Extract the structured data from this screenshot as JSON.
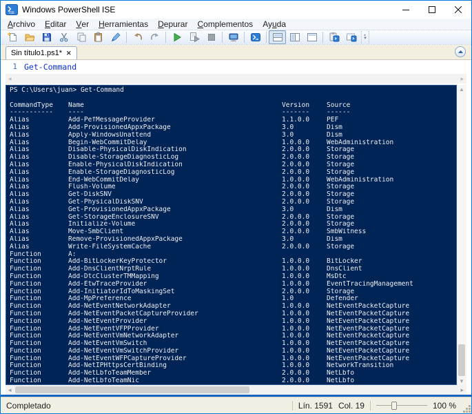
{
  "window": {
    "title": "Windows PowerShell ISE"
  },
  "colors": {
    "accent": "#0078d7",
    "console_bg": "#012456",
    "console_fg": "#eeeef2",
    "status_bg": "#f1efe3",
    "cmdlet_blue": "#0a2fd0"
  },
  "menu": {
    "items": [
      {
        "id": "archivo",
        "pre": "",
        "key": "A",
        "rest": "rchivo"
      },
      {
        "id": "editar",
        "pre": "",
        "key": "E",
        "rest": "ditar"
      },
      {
        "id": "ver",
        "pre": "",
        "key": "V",
        "rest": "er"
      },
      {
        "id": "herramientas",
        "pre": "",
        "key": "H",
        "rest": "erramientas"
      },
      {
        "id": "depurar",
        "pre": "",
        "key": "D",
        "rest": "epurar"
      },
      {
        "id": "complementos",
        "pre": "",
        "key": "C",
        "rest": "omplementos"
      },
      {
        "id": "ayuda",
        "pre": "Ay",
        "key": "u",
        "rest": "da"
      }
    ]
  },
  "toolbar": {
    "items": [
      {
        "id": "new-script",
        "icon": "new-script"
      },
      {
        "id": "open-script",
        "icon": "open-script"
      },
      {
        "id": "save-script",
        "icon": "save-script"
      },
      {
        "id": "cut",
        "icon": "cut"
      },
      {
        "id": "copy",
        "icon": "copy"
      },
      {
        "id": "paste",
        "icon": "paste"
      },
      {
        "id": "clear-console-pane",
        "icon": "clear-console"
      },
      {
        "sep": true
      },
      {
        "id": "undo",
        "icon": "undo"
      },
      {
        "id": "redo",
        "icon": "redo"
      },
      {
        "sep": true
      },
      {
        "id": "run-script",
        "icon": "run-script"
      },
      {
        "id": "run-selection",
        "icon": "run-selection"
      },
      {
        "id": "stop-operation",
        "icon": "stop",
        "disabled": true
      },
      {
        "sep": true
      },
      {
        "id": "new-remote-powershell-tab",
        "icon": "remote-tab"
      },
      {
        "sep": true
      },
      {
        "id": "start-powershell-exe",
        "icon": "powershell"
      },
      {
        "sep": true
      },
      {
        "id": "show-script-pane-top",
        "icon": "pane-top",
        "selected": true
      },
      {
        "id": "show-script-pane-right",
        "icon": "pane-right"
      },
      {
        "id": "show-script-pane-maximized",
        "icon": "pane-max"
      },
      {
        "sep": true
      },
      {
        "id": "show-command-addon",
        "icon": "cmd-clipboard"
      },
      {
        "id": "show-command-window",
        "icon": "cmd-window"
      }
    ]
  },
  "editor": {
    "tab_title": "Sin título1.ps1*",
    "line_number": "1",
    "code": "Get-Command"
  },
  "console": {
    "prompt_line": "PS C:\\Users\\juan> Get-Command",
    "columns": [
      "CommandType",
      "Name",
      "Version",
      "Source"
    ],
    "underlines": [
      "-----------",
      "----",
      "-------",
      "------"
    ],
    "rows": [
      [
        "Alias",
        "Add-PefMessageProvider",
        "1.1.0.0",
        "PEF"
      ],
      [
        "Alias",
        "Add-ProvisionedAppxPackage",
        "3.0",
        "Dism"
      ],
      [
        "Alias",
        "Apply-WindowsUnattend",
        "3.0",
        "Dism"
      ],
      [
        "Alias",
        "Begin-WebCommitDelay",
        "1.0.0.0",
        "WebAdministration"
      ],
      [
        "Alias",
        "Disable-PhysicalDiskIndication",
        "2.0.0.0",
        "Storage"
      ],
      [
        "Alias",
        "Disable-StorageDiagnosticLog",
        "2.0.0.0",
        "Storage"
      ],
      [
        "Alias",
        "Enable-PhysicalDiskIndication",
        "2.0.0.0",
        "Storage"
      ],
      [
        "Alias",
        "Enable-StorageDiagnosticLog",
        "2.0.0.0",
        "Storage"
      ],
      [
        "Alias",
        "End-WebCommitDelay",
        "1.0.0.0",
        "WebAdministration"
      ],
      [
        "Alias",
        "Flush-Volume",
        "2.0.0.0",
        "Storage"
      ],
      [
        "Alias",
        "Get-DiskSNV",
        "2.0.0.0",
        "Storage"
      ],
      [
        "Alias",
        "Get-PhysicalDiskSNV",
        "2.0.0.0",
        "Storage"
      ],
      [
        "Alias",
        "Get-ProvisionedAppxPackage",
        "3.0",
        "Dism"
      ],
      [
        "Alias",
        "Get-StorageEnclosureSNV",
        "2.0.0.0",
        "Storage"
      ],
      [
        "Alias",
        "Initialize-Volume",
        "2.0.0.0",
        "Storage"
      ],
      [
        "Alias",
        "Move-SmbClient",
        "2.0.0.0",
        "SmbWitness"
      ],
      [
        "Alias",
        "Remove-ProvisionedAppxPackage",
        "3.0",
        "Dism"
      ],
      [
        "Alias",
        "Write-FileSystemCache",
        "2.0.0.0",
        "Storage"
      ],
      [
        "Function",
        "A:",
        "",
        ""
      ],
      [
        "Function",
        "Add-BitLockerKeyProtector",
        "1.0.0.0",
        "BitLocker"
      ],
      [
        "Function",
        "Add-DnsClientNrptRule",
        "1.0.0.0",
        "DnsClient"
      ],
      [
        "Function",
        "Add-DtcClusterTMMapping",
        "1.0.0.0",
        "MsDtc"
      ],
      [
        "Function",
        "Add-EtwTraceProvider",
        "1.0.0.0",
        "EventTracingManagement"
      ],
      [
        "Function",
        "Add-InitiatorIdToMaskingSet",
        "2.0.0.0",
        "Storage"
      ],
      [
        "Function",
        "Add-MpPreference",
        "1.0",
        "Defender"
      ],
      [
        "Function",
        "Add-NetEventNetworkAdapter",
        "1.0.0.0",
        "NetEventPacketCapture"
      ],
      [
        "Function",
        "Add-NetEventPacketCaptureProvider",
        "1.0.0.0",
        "NetEventPacketCapture"
      ],
      [
        "Function",
        "Add-NetEventProvider",
        "1.0.0.0",
        "NetEventPacketCapture"
      ],
      [
        "Function",
        "Add-NetEventVFPProvider",
        "1.0.0.0",
        "NetEventPacketCapture"
      ],
      [
        "Function",
        "Add-NetEventVmNetworkAdapter",
        "1.0.0.0",
        "NetEventPacketCapture"
      ],
      [
        "Function",
        "Add-NetEventVmSwitch",
        "1.0.0.0",
        "NetEventPacketCapture"
      ],
      [
        "Function",
        "Add-NetEventVmSwitchProvider",
        "1.0.0.0",
        "NetEventPacketCapture"
      ],
      [
        "Function",
        "Add-NetEventWFPCaptureProvider",
        "1.0.0.0",
        "NetEventPacketCapture"
      ],
      [
        "Function",
        "Add-NetIPHttpsCertBinding",
        "1.0.0.0",
        "NetworkTransition"
      ],
      [
        "Function",
        "Add-NetLbfoTeamMember",
        "2.0.0.0",
        "NetLbfo"
      ],
      [
        "Function",
        "Add-NetLbfoTeamNic",
        "2.0.0.0",
        "NetLbfo"
      ]
    ]
  },
  "status": {
    "text": "Completado",
    "line": "Lín. 1591",
    "col": "Col. 19",
    "zoom": "100 %"
  }
}
